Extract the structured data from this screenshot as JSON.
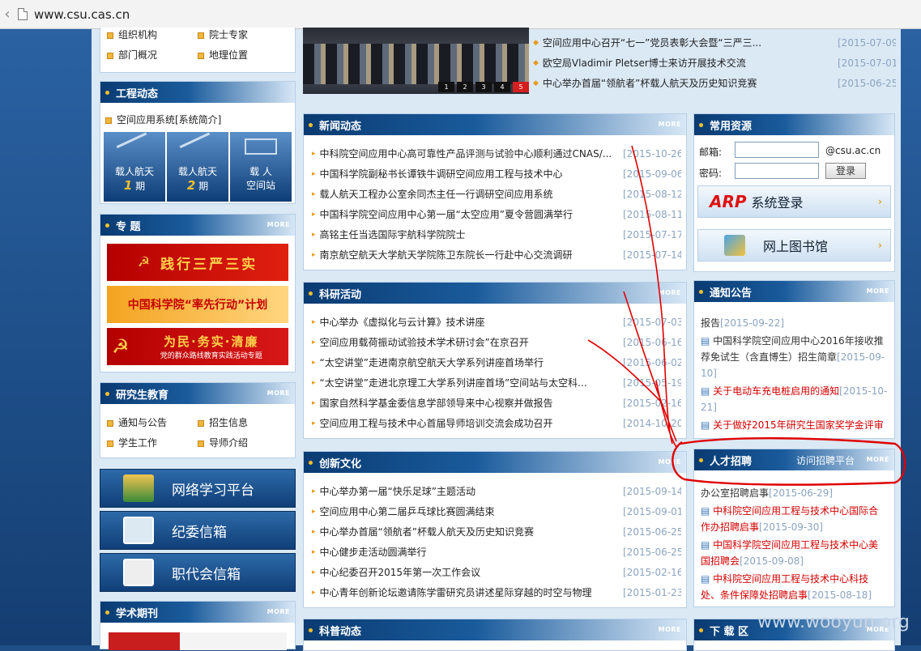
{
  "browser": {
    "url": "www.csu.cas.cn"
  },
  "left": {
    "top_links": [
      "组织机构",
      "院士专家",
      "部门概况",
      "地理位置"
    ],
    "engineering": {
      "title": "工程动态",
      "intro": "空间应用系统[系统简介]",
      "tiles": [
        {
          "line1": "载人航天",
          "num": "1",
          "unit": "期"
        },
        {
          "line1": "载人航天",
          "num": "2",
          "unit": "期"
        },
        {
          "line1": "载 人",
          "line2": "空间站"
        }
      ]
    },
    "special": {
      "title": "专 题",
      "more": "MORE",
      "banners": [
        {
          "text": "践行三严三实",
          "sub": ""
        },
        {
          "text": "中国科学院“率先行动”计划",
          "sub": ""
        },
        {
          "text": "为民·务实·清廉",
          "sub": "党的群众路线教育实践活动专题"
        }
      ]
    },
    "grad": {
      "title": "研究生教育",
      "more": "MORE",
      "links": [
        "通知与公告",
        "招生信息",
        "学生工作",
        "导师介绍"
      ]
    },
    "buttons": [
      "网络学习平台",
      "纪委信箱",
      "职代会信箱"
    ],
    "journal": {
      "title": "学术期刊",
      "more": "MORE"
    }
  },
  "center": {
    "slider_pages": [
      "1",
      "2",
      "3",
      "4",
      "5"
    ],
    "top_news": [
      {
        "text": "空间应用中心召开“七一”党员表彰大会暨“三严三...",
        "date": "[2015-07-09]"
      },
      {
        "text": "欧空局Vladimir Pletser博士来访开展技术交流",
        "date": "[2015-07-01]"
      },
      {
        "text": "中心举办首届“领航者”杯载人航天及历史知识竞赛",
        "date": "[2015-06-25]"
      }
    ],
    "sections": [
      {
        "title": "新闻动态",
        "more": "MORE",
        "items": [
          {
            "text": "中科院空间应用中心高可靠性产品评测与试验中心顺利通过CNAS/...",
            "date": "[2015-10-26]"
          },
          {
            "text": "中国科学院副秘书长谭铁牛调研空间应用工程与技术中心",
            "date": "[2015-09-06]"
          },
          {
            "text": "载人航天工程办公室余同杰主任一行调研空间应用系统",
            "date": "[2015-08-12]"
          },
          {
            "text": "中国科学院空间应用中心第一届“太空应用”夏令营圆满举行",
            "date": "[2015-08-11]"
          },
          {
            "text": "高铭主任当选国际宇航科学院院士",
            "date": "[2015-07-17]"
          },
          {
            "text": "南京航空航天大学航天学院陈卫东院长一行赴中心交流调研",
            "date": "[2015-07-14]"
          }
        ]
      },
      {
        "title": "科研活动",
        "more": "MORE",
        "items": [
          {
            "text": "中心举办《虚拟化与云计算》技术讲座",
            "date": "[2015-07-03]"
          },
          {
            "text": "空间应用载荷振动试验技术学术研讨会”在京召开",
            "date": "[2015-06-16]"
          },
          {
            "text": "“太空讲堂”走进南京航空航天大学系列讲座首场举行",
            "date": "[2015-06-02]"
          },
          {
            "text": "“太空讲堂”走进北京理工大学系列讲座首场”空间站与太空科...",
            "date": "[2015-05-19]"
          },
          {
            "text": "国家自然科学基金委信息学部领导来中心视察并做报告",
            "date": "[2015-02-16]"
          },
          {
            "text": "空间应用工程与技术中心首届导师培训交流会成功召开",
            "date": "[2014-10-20]"
          }
        ]
      },
      {
        "title": "创新文化",
        "more": "MORE",
        "items": [
          {
            "text": "中心举办第一届“快乐足球”主题活动",
            "date": "[2015-09-14]"
          },
          {
            "text": "空间应用中心第二届乒乓球比赛圆满结束",
            "date": "[2015-09-01]"
          },
          {
            "text": "中心举办首届“领航者”杯载人航天及历史知识竞赛",
            "date": "[2015-06-25]"
          },
          {
            "text": "中心健步走活动圆满举行",
            "date": "[2015-06-25]"
          },
          {
            "text": "中心纪委召开2015年第一次工作会议",
            "date": "[2015-02-16]"
          },
          {
            "text": "中心青年创新论坛邀请陈学雷研究员讲述星际穿越的时空与物理",
            "date": "[2015-01-23]"
          }
        ]
      },
      {
        "title": "科普动态",
        "more": "MORE",
        "items": []
      }
    ]
  },
  "right": {
    "resources": {
      "title": "常用资源",
      "email_label": "邮箱:",
      "email_suffix": "@csu.ac.cn",
      "password_label": "密码:",
      "login_button": "登录",
      "arp_logo": "ARP",
      "arp_label": "系统登录",
      "library_label": "网上图书馆"
    },
    "notice": {
      "title": "通知公告",
      "more": "MORE",
      "items": [
        {
          "text": "报告",
          "date": "[2015-09-22]",
          "style": "normal"
        },
        {
          "text": "中国科学院空间应用中心2016年接收推荐免试生（含直博生）招生简章",
          "date": "[2015-09-10]",
          "style": "normal"
        },
        {
          "text": "关于电动车充电桩启用的通知",
          "date": "[2015-10-21]",
          "style": "red"
        },
        {
          "text": "关于做好2015年研究生国家奖学金评审",
          "date": "",
          "style": "red"
        }
      ]
    },
    "talent": {
      "title": "人才招聘",
      "platform_link": "访问招聘平台",
      "more": "MORE",
      "items": [
        {
          "text": "办公室招聘启事",
          "date": "[2015-06-29]",
          "style": "normal"
        },
        {
          "text": "中科院空间应用工程与技术中心国际合作办招聘启事",
          "date": "[2015-09-30]",
          "style": "red"
        },
        {
          "text": "中国科学院空间应用工程与技术中心美国招聘会",
          "date": "[2015-09-08]",
          "style": "red"
        },
        {
          "text": "中科院空间应用工程与技术中心科技处、条件保障处招聘启事",
          "date": "[2015-08-18]",
          "style": "red"
        }
      ]
    },
    "download": {
      "title": "下 载 区",
      "more": "MORE"
    }
  },
  "watermark": "www.wooyun.org",
  "colors": {
    "annotation": "#e00000",
    "header_dark": "#0a3b72",
    "accent": "#f6c02b"
  }
}
